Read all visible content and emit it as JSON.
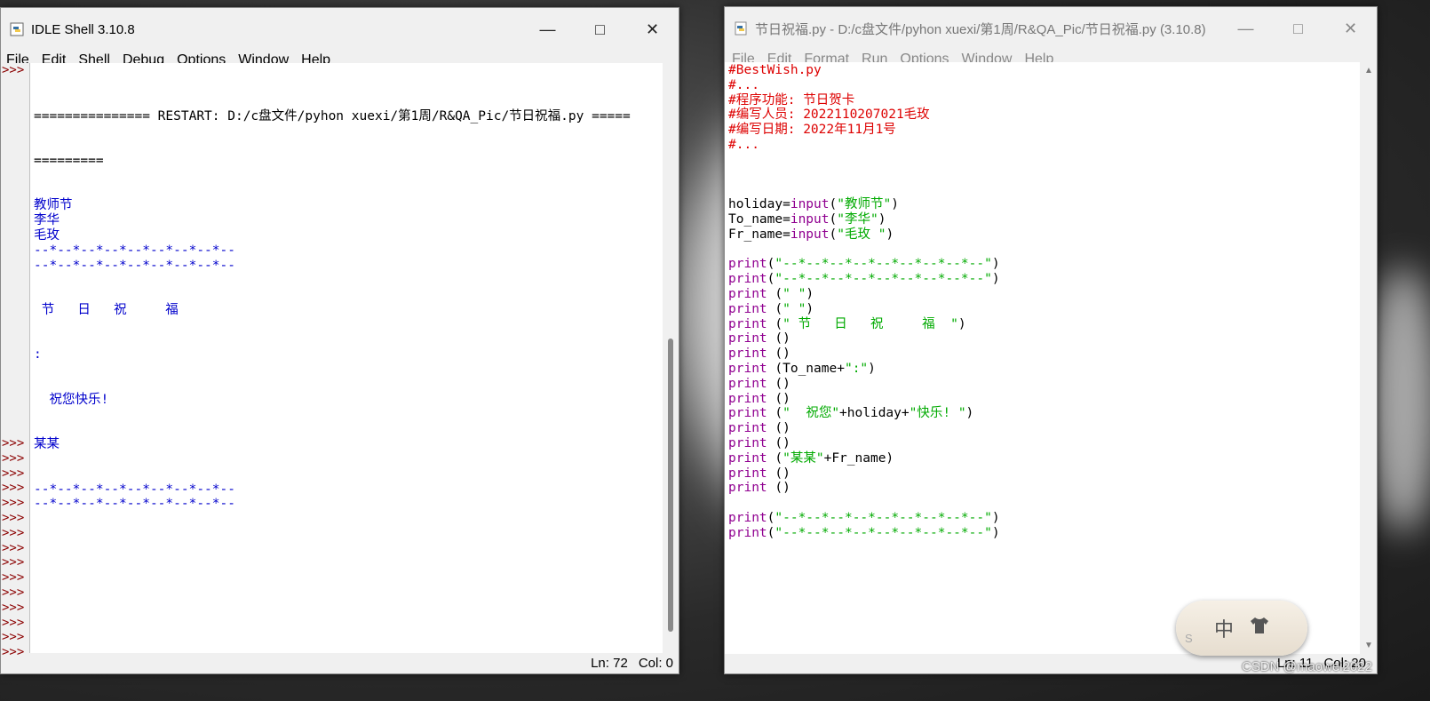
{
  "shell": {
    "title": "IDLE Shell 3.10.8",
    "menu": [
      "File",
      "Edit",
      "Shell",
      "Debug",
      "Options",
      "Window",
      "Help"
    ],
    "restart_line": "=============== RESTART: D:/c盘文件/pyhon xuexi/第1周/R&QA_Pic/节日祝福.py =====",
    "restart_line2": "=========",
    "output": [
      "教师节",
      "李华",
      "毛玫",
      "--*--*--*--*--*--*--*--*--",
      "--*--*--*--*--*--*--*--*--",
      "",
      "",
      " 节   日   祝     福",
      "",
      "",
      ":",
      "",
      "",
      "  祝您快乐!",
      "",
      "",
      "某某",
      "",
      "",
      "--*--*--*--*--*--*--*--*--",
      "--*--*--*--*--*--*--*--*--"
    ],
    "prompt": ">>>",
    "status_ln": "Ln: 72",
    "status_col": "Col: 0"
  },
  "editor": {
    "title": "节日祝福.py - D:/c盘文件/pyhon xuexi/第1周/R&QA_Pic/节日祝福.py (3.10.8)",
    "menu": [
      "File",
      "Edit",
      "Format",
      "Run",
      "Options",
      "Window",
      "Help"
    ],
    "comments": [
      "#BestWish.py",
      "#...",
      "#程序功能: 节日贺卡",
      "#编写人员: 2022110207021毛玫",
      "#编写日期: 2022年11月1号",
      "#..."
    ],
    "inputs": [
      {
        "var": "holiday",
        "arg": "\"教师节\""
      },
      {
        "var": "To_name",
        "arg": "\"李华\""
      },
      {
        "var": "Fr_name",
        "arg": "\"毛玫 \""
      }
    ],
    "prints": [
      {
        "kw": "print",
        "a": "(",
        "s": "\"--*--*--*--*--*--*--*--*--\"",
        "b": ")"
      },
      {
        "kw": "print",
        "a": "(",
        "s": "\"--*--*--*--*--*--*--*--*--\"",
        "b": ")"
      },
      {
        "kw": "print",
        "a": " (",
        "s": "\" \"",
        "b": ")"
      },
      {
        "kw": "print",
        "a": " (",
        "s": "\" \"",
        "b": ")"
      },
      {
        "kw": "print",
        "a": " (",
        "s": "\" 节   日   祝     福  \"",
        "b": ")"
      },
      {
        "kw": "print",
        "a": " ()",
        "s": "",
        "b": ""
      },
      {
        "kw": "print",
        "a": " ()",
        "s": "",
        "b": ""
      },
      {
        "kw": "print",
        "a": " (To_name+",
        "s": "\":\"",
        "b": ")"
      },
      {
        "kw": "print",
        "a": " ()",
        "s": "",
        "b": ""
      },
      {
        "kw": "print",
        "a": " ()",
        "s": "",
        "b": ""
      },
      {
        "kw": "print",
        "a": " (",
        "s": "\"  祝您\"",
        "b": "+holiday+",
        "s2": "\"快乐! \"",
        "b2": ")"
      },
      {
        "kw": "print",
        "a": " ()",
        "s": "",
        "b": ""
      },
      {
        "kw": "print",
        "a": " ()",
        "s": "",
        "b": ""
      },
      {
        "kw": "print",
        "a": " (",
        "s": "\"某某\"",
        "b": "+Fr_name)"
      },
      {
        "kw": "print",
        "a": " ()",
        "s": "",
        "b": ""
      },
      {
        "kw": "print",
        "a": " ()",
        "s": "",
        "b": ""
      }
    ],
    "final_prints": [
      {
        "kw": "print",
        "a": "(",
        "s": "\"--*--*--*--*--*--*--*--*--\"",
        "b": ")"
      },
      {
        "kw": "print",
        "a": "(",
        "s": "\"--*--*--*--*--*--*--*--*--\"",
        "b": ")"
      }
    ],
    "status_ln": "Ln: 11",
    "status_col": "Col: 20"
  },
  "ime": {
    "label": "中",
    "mode": "S"
  },
  "watermark": "CSDN @maowei2022",
  "colors": {
    "comment": "#dd0000",
    "keyword": "#900090",
    "string": "#00aa00",
    "output": "#0000cc",
    "prompt": "#8b0000"
  }
}
